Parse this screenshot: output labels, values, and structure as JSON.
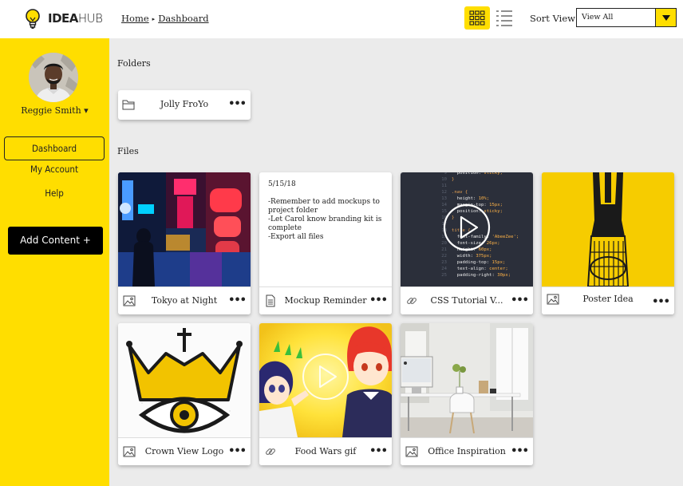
{
  "brand": {
    "bold": "IDEA",
    "light": "HUB"
  },
  "breadcrumb": {
    "home": "Home",
    "separator": "▸",
    "current": "Dashboard"
  },
  "sort": {
    "label": "Sort View:",
    "value": "View All"
  },
  "user": {
    "name": "Reggie Smith",
    "caret": "▾"
  },
  "nav": [
    {
      "label": "Dashboard",
      "active": true
    },
    {
      "label": "My Account"
    },
    {
      "label": "Help"
    }
  ],
  "add_content": "Add Content +",
  "sections": {
    "folders": "Folders",
    "files": "Files"
  },
  "folders": [
    {
      "name": "Jolly FroYo"
    }
  ],
  "more_label": "•••",
  "files": [
    {
      "name": "Tokyo at Night",
      "icon": "image-icon"
    },
    {
      "name": "Mockup Reminder",
      "icon": "document-icon",
      "memo": {
        "date": "5/15/18",
        "lines": [
          "-Remember to add mockups to project folder",
          "-Let Carol know branding kit is complete",
          "-Export all files"
        ]
      }
    },
    {
      "name": "CSS Tutorial V...",
      "icon": "link-icon",
      "code": [
        "position: sticky;",
        "}",
        "",
        ".nav {",
        "height: 10%;",
        "margin-top: 15px;",
        "position: sticky;",
        "}",
        "",
        "title {",
        "font-family: 'AbeeZee';",
        "font-size: 26px;",
        "height: 60px;",
        "width: 375px;",
        "padding-top: 15px;",
        "text-align: center;",
        "padding-right: 30px;"
      ]
    },
    {
      "name": "Poster Idea",
      "icon": "image-icon"
    },
    {
      "name": "Crown View Logo",
      "icon": "image-icon"
    },
    {
      "name": "Food Wars gif",
      "icon": "link-icon"
    },
    {
      "name": "Office Inspiration",
      "icon": "image-icon"
    }
  ],
  "colors": {
    "accent": "#ffde00",
    "background": "#ebebeb",
    "button_dark": "#000000"
  }
}
